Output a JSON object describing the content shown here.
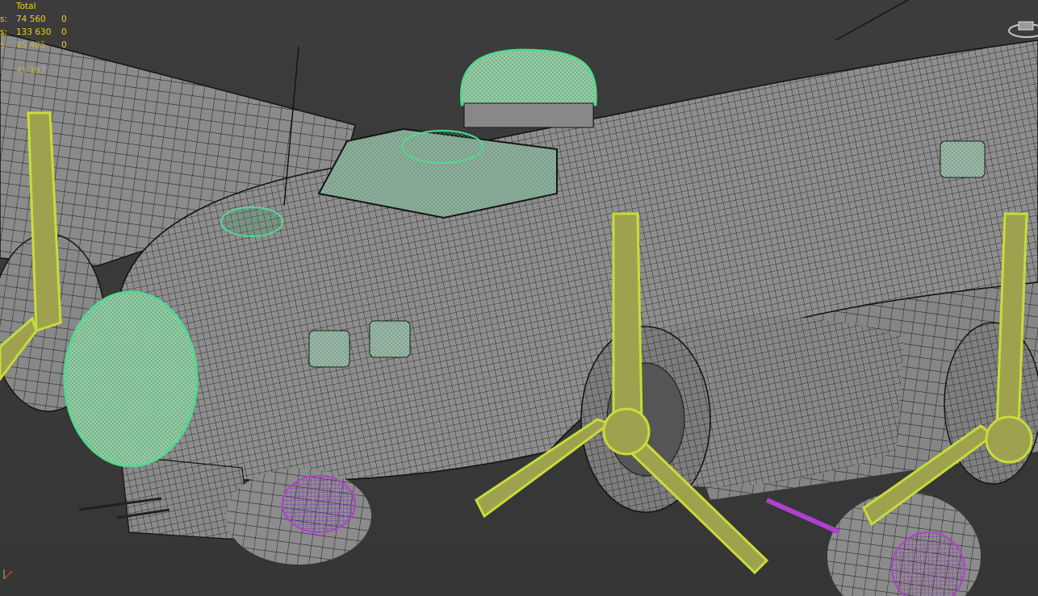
{
  "viewport": {
    "background": "#3a3a3a",
    "wire_color": "#141414",
    "mesh_fill": "#8a8a8a",
    "glass_color": "#55d890",
    "prop_color": "#c8dc3a",
    "gear_color": "#b040d0"
  },
  "stats": {
    "header": "Total",
    "rows": [
      {
        "label": "s:",
        "total": "74 560",
        "selected": "0"
      },
      {
        "label": "s:",
        "total": "133 630",
        "selected": "0"
      },
      {
        "label": "s:",
        "total": "85 405",
        "selected": "0"
      },
      {
        "label": ":",
        "total": "41 197",
        "selected": ""
      }
    ]
  },
  "icons": {
    "viewcube": "viewcube-icon",
    "axis": "axis-tripod-icon"
  }
}
